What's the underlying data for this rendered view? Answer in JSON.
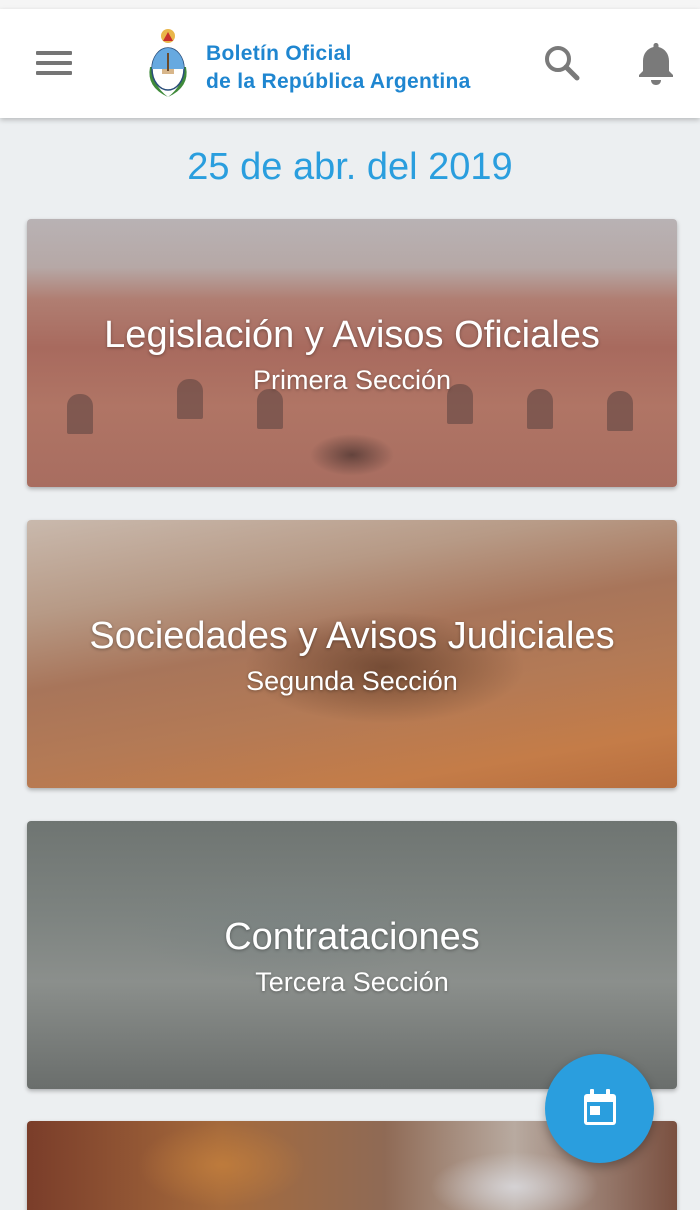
{
  "app": {
    "title_line1": "Boletín Oficial",
    "title_line2": "de la República Argentina",
    "brand_color": "#1f86d0",
    "accent_color": "#2a9ede"
  },
  "header": {
    "menu_icon": "hamburger-menu-icon",
    "logo": "argentina-coat-of-arms-logo",
    "search_icon": "search-icon",
    "notifications_icon": "bell-icon"
  },
  "date": "25 de abr. del 2019",
  "sections": [
    {
      "title": "Legislación y Avisos Oficiales",
      "subtitle": "Primera Sección"
    },
    {
      "title": "Sociedades y Avisos Judiciales",
      "subtitle": "Segunda Sección"
    },
    {
      "title": "Contrataciones",
      "subtitle": "Tercera Sección"
    },
    {
      "title": "",
      "subtitle": ""
    }
  ],
  "fab": {
    "icon": "calendar-icon"
  }
}
